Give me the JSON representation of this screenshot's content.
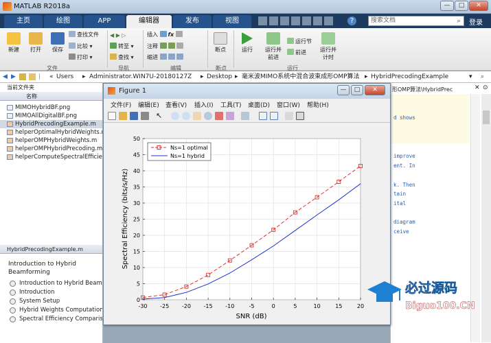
{
  "window": {
    "title": "MATLAB R2018a",
    "min": "—",
    "max": "□",
    "close": "✕"
  },
  "tabs": [
    {
      "label": "主页"
    },
    {
      "label": "绘图"
    },
    {
      "label": "APP"
    },
    {
      "label": "编辑器"
    },
    {
      "label": "发布"
    },
    {
      "label": "视图"
    }
  ],
  "search": {
    "placeholder": "搜索文档"
  },
  "login": "登录",
  "ribbon": {
    "new": "新建",
    "open": "打开",
    "save": "保存",
    "find_files": "查找文件",
    "compare": "比较",
    "print": "打印",
    "goto": "转至",
    "find": "查找",
    "insert": "插入",
    "comment": "注释",
    "indent": "缩进",
    "breakpoints": "断点",
    "run": "运行",
    "run_advance": "运行并\n前进",
    "run_section": "运行节",
    "advance": "前进",
    "run_time": "运行并\n计时",
    "groups": {
      "file": "文件",
      "navigate": "导航",
      "edit": "编辑",
      "breakpoints": "断点",
      "run": "运行"
    }
  },
  "address": {
    "path": [
      "«",
      "Users",
      "Administrator.WIN7U-20180127Z",
      "Desktop",
      "毫米波MIMO系统中混合波束成形OMP算法",
      "HybridPrecodingExample"
    ]
  },
  "current_folder": {
    "title": "当前文件夹",
    "column": "名称",
    "files": [
      "MIMOHybridBF.png",
      "MIMOAllDigitalBF.png",
      "HybridPrecodingExample.m",
      "helperOptimalHybridWeights.m",
      "helperOMPHybridWeights.m",
      "helperOMPHybridPrecoding.m",
      "helperComputeSpectralEfficiency.m"
    ]
  },
  "details": {
    "title": "HybridPrecodingExample.m",
    "heading": "Introduction to Hybrid Beamforming",
    "items": [
      "Introduction to Hybrid Beamforming",
      "Introduction",
      "System Setup",
      "Hybrid Weights Computation",
      "Spectral Efficiency Comparison"
    ]
  },
  "editor": {
    "path_tail": "形OMP算法\\HybridPrec",
    "lines": [
      "d shows",
      "",
      "",
      "improve",
      "ent. In",
      "",
      "k. Then",
      "tain",
      "ital",
      "",
      "diagram",
      "ceive"
    ]
  },
  "figure": {
    "title": "Figure 1",
    "menu": [
      "文件(F)",
      "编辑(E)",
      "查看(V)",
      "插入(I)",
      "工具(T)",
      "桌面(D)",
      "窗口(W)",
      "帮助(H)"
    ]
  },
  "chart_data": {
    "type": "line",
    "xlabel": "SNR (dB)",
    "ylabel": "Spectral Efficiency (bits/s/Hz)",
    "xlim": [
      -30,
      20
    ],
    "ylim": [
      0,
      50
    ],
    "xticks": [
      -30,
      -25,
      -20,
      -15,
      -10,
      -5,
      0,
      5,
      10,
      15,
      20
    ],
    "yticks": [
      0,
      5,
      10,
      15,
      20,
      25,
      30,
      35,
      40,
      45,
      50
    ],
    "grid": true,
    "legend_position": "top-left",
    "series": [
      {
        "name": "Ns=1 optimal",
        "color": "#e03030",
        "dash": true,
        "marker": "square",
        "x": [
          -30,
          -25,
          -20,
          -15,
          -10,
          -5,
          0,
          5,
          10,
          15,
          20
        ],
        "values": [
          0.7,
          1.6,
          4.1,
          7.7,
          12.2,
          16.9,
          21.7,
          27.1,
          31.8,
          36.6,
          41.5
        ]
      },
      {
        "name": "Ns=1 hybrid",
        "color": "#2030d0",
        "dash": false,
        "marker": "none",
        "x": [
          -30,
          -25,
          -20,
          -15,
          -10,
          -5,
          0,
          5,
          10,
          15,
          20
        ],
        "values": [
          0.2,
          0.7,
          2.3,
          4.9,
          8.3,
          12.4,
          16.7,
          21.5,
          26.3,
          31.0,
          36.0
        ]
      }
    ]
  },
  "watermark": {
    "cn": "必过源码",
    "en": "Biguo100.CN"
  }
}
